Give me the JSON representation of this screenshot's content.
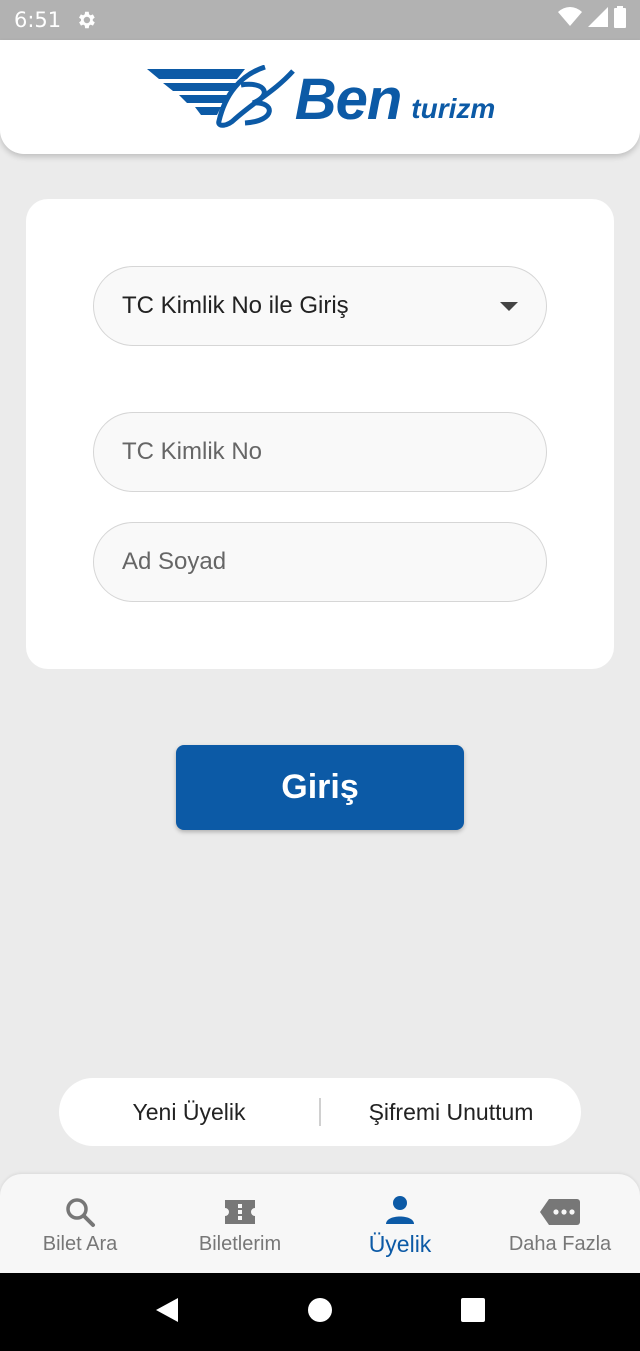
{
  "status_bar": {
    "time": "6:51",
    "icons": [
      "gear-icon",
      "wifi-icon",
      "signal-icon",
      "battery-icon"
    ]
  },
  "header": {
    "logo_brand": "Ben",
    "logo_sub": "turizm",
    "brand_color": "#0c5aa6"
  },
  "login_form": {
    "method_select": {
      "value": "TC Kimlik No ile Giriş"
    },
    "tc_input": {
      "placeholder": "TC Kimlik No"
    },
    "name_input": {
      "placeholder": "Ad Soyad"
    }
  },
  "login_button": {
    "label": "Giriş"
  },
  "account_links": {
    "register": "Yeni Üyelik",
    "forgot_password": "Şifremi Unuttum"
  },
  "bottom_nav": {
    "items": [
      {
        "label": "Bilet Ara",
        "icon": "search-icon",
        "active": false
      },
      {
        "label": "Biletlerim",
        "icon": "ticket-icon",
        "active": false
      },
      {
        "label": "Üyelik",
        "icon": "person-icon",
        "active": true
      },
      {
        "label": "Daha Fazla",
        "icon": "more-icon",
        "active": false
      }
    ]
  },
  "system_nav": {
    "icons": [
      "back-icon",
      "home-icon",
      "recents-icon"
    ]
  }
}
